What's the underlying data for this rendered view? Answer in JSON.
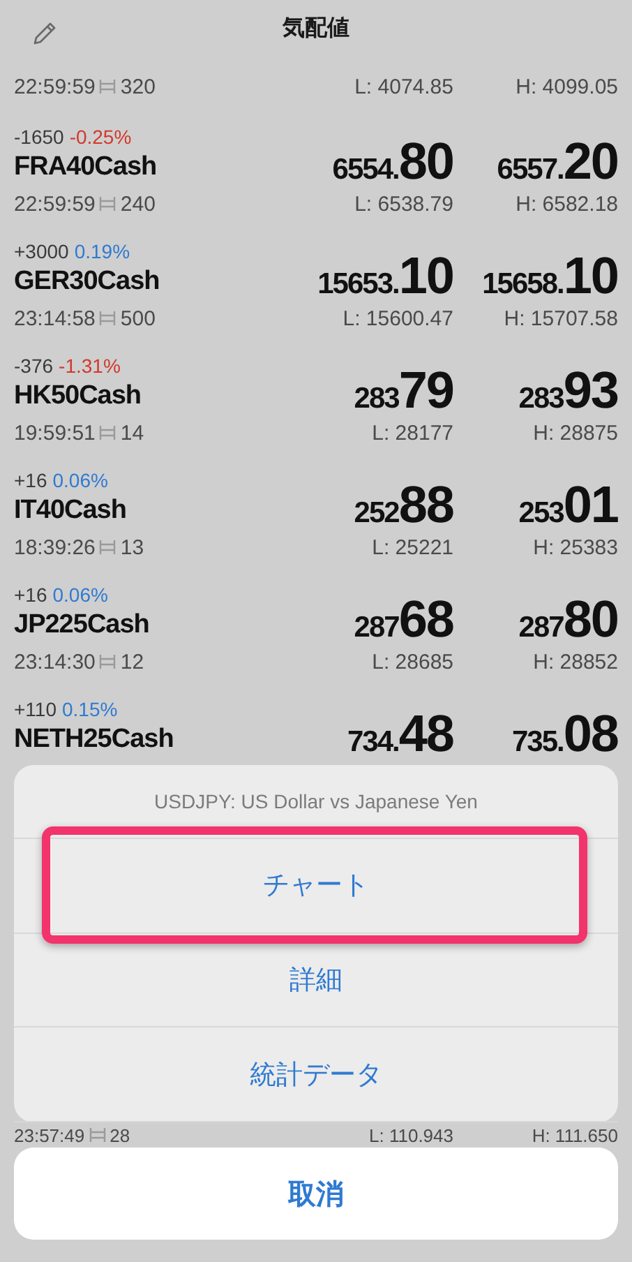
{
  "header": {
    "title": "気配値"
  },
  "rows": [
    {
      "time": "22:59:59",
      "volume": "320",
      "low": "L: 4074.85",
      "high": "H: 4099.05"
    },
    {
      "change": "-1650",
      "percent": "-0.25%",
      "color": "#d2382c",
      "symbol": "FRA40Cash",
      "bid": {
        "prefix": "6554.",
        "big": "80"
      },
      "ask": {
        "prefix": "6557.",
        "big": "20"
      },
      "time": "22:59:59",
      "volume": "240",
      "low": "L: 6538.79",
      "high": "H: 6582.18"
    },
    {
      "change": "+3000",
      "percent": "0.19%",
      "color": "#2f7ad1",
      "symbol": "GER30Cash",
      "bid": {
        "prefix": "15653.",
        "big": "10"
      },
      "ask": {
        "prefix": "15658.",
        "big": "10"
      },
      "time": "23:14:58",
      "volume": "500",
      "low": "L: 15600.47",
      "high": "H: 15707.58"
    },
    {
      "change": "-376",
      "percent": "-1.31%",
      "color": "#d2382c",
      "symbol": "HK50Cash",
      "bid": {
        "prefix": "283",
        "big": "79"
      },
      "ask": {
        "prefix": "283",
        "big": "93"
      },
      "time": "19:59:51",
      "volume": "14",
      "low": "L: 28177",
      "high": "H: 28875"
    },
    {
      "change": "+16",
      "percent": "0.06%",
      "color": "#2f7ad1",
      "symbol": "IT40Cash",
      "bid": {
        "prefix": "252",
        "big": "88"
      },
      "ask": {
        "prefix": "253",
        "big": "01"
      },
      "time": "18:39:26",
      "volume": "13",
      "low": "L: 25221",
      "high": "H: 25383"
    },
    {
      "change": "+16",
      "percent": "0.06%",
      "color": "#2f7ad1",
      "symbol": "JP225Cash",
      "bid": {
        "prefix": "287",
        "big": "68"
      },
      "ask": {
        "prefix": "287",
        "big": "80"
      },
      "time": "23:14:30",
      "volume": "12",
      "low": "L: 28685",
      "high": "H: 28852"
    },
    {
      "change": "+110",
      "percent": "0.15%",
      "color": "#2f7ad1",
      "symbol": "NETH25Cash",
      "bid": {
        "prefix": "734.",
        "big": "48"
      },
      "ask": {
        "prefix": "735.",
        "big": "08"
      }
    }
  ],
  "peek_row": {
    "time": "23:57:49",
    "volume": "28",
    "low": "L: 110.943",
    "high": "H: 111.650"
  },
  "action_sheet": {
    "title": "USDJPY: US Dollar vs Japanese Yen",
    "items": [
      {
        "label": "チャート",
        "highlighted": true
      },
      {
        "label": "詳細",
        "highlighted": false
      },
      {
        "label": "統計データ",
        "highlighted": false
      }
    ],
    "cancel": "取消"
  }
}
